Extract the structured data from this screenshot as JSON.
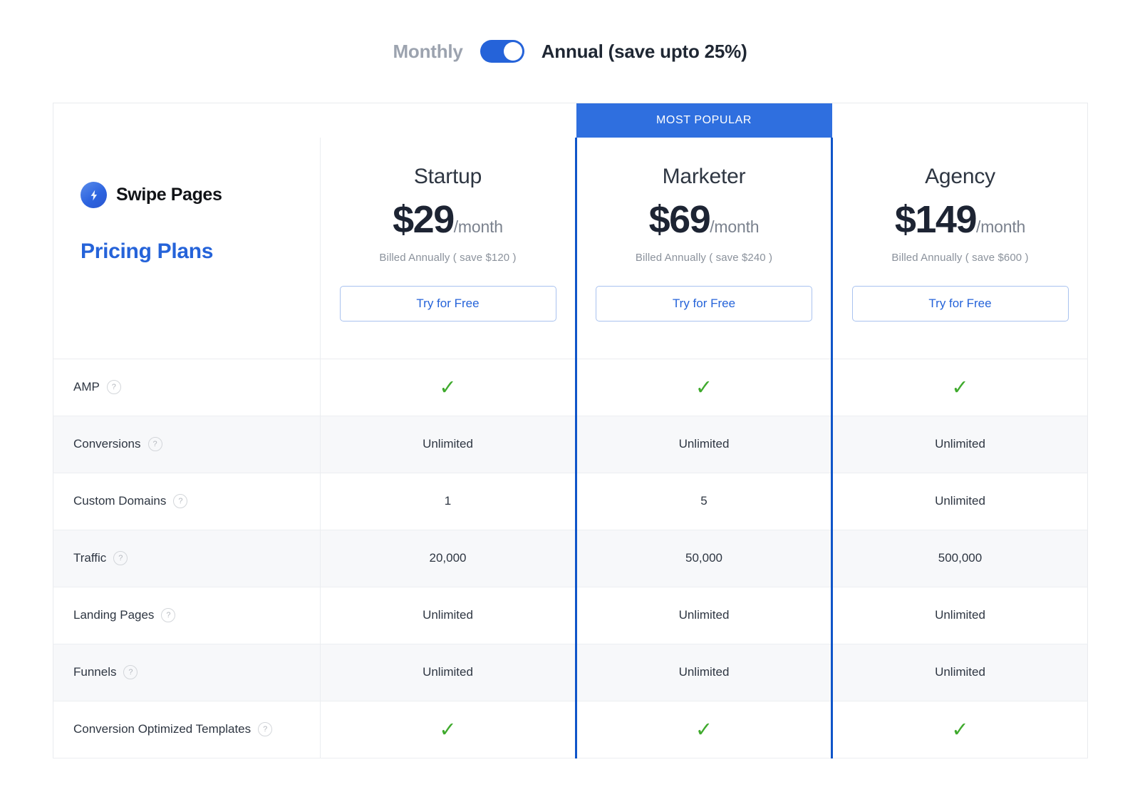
{
  "billing": {
    "monthly_label": "Monthly",
    "annual_label": "Annual (save upto 25%)",
    "toggle_state": "annual",
    "accent_color": "#2563d9"
  },
  "brand": {
    "name": "Swipe Pages",
    "logo_icon": "lightning-bolt-icon",
    "page_title": "Pricing Plans",
    "title_color": "#2563d9"
  },
  "popular_badge": {
    "label": "MOST POPULAR",
    "plan": "Marketer",
    "background": "#2f6fdf",
    "border_color": "#0f55c9"
  },
  "plans": [
    {
      "name": "Startup",
      "price": "$29",
      "period": "/month",
      "billed_note": "Billed Annually ( save $120 )",
      "cta": "Try for Free",
      "popular": false
    },
    {
      "name": "Marketer",
      "price": "$69",
      "period": "/month",
      "billed_note": "Billed Annually ( save $240 )",
      "cta": "Try for Free",
      "popular": true
    },
    {
      "name": "Agency",
      "price": "$149",
      "period": "/month",
      "billed_note": "Billed Annually ( save $600 )",
      "cta": "Try for Free",
      "popular": false
    }
  ],
  "features": [
    {
      "label": "AMP",
      "help": "?",
      "startup": "check",
      "marketer": "check",
      "agency": "check"
    },
    {
      "label": "Conversions",
      "help": "?",
      "startup": "Unlimited",
      "marketer": "Unlimited",
      "agency": "Unlimited"
    },
    {
      "label": "Custom Domains",
      "help": "?",
      "startup": "1",
      "marketer": "5",
      "agency": "Unlimited"
    },
    {
      "label": "Traffic",
      "help": "?",
      "startup": "20,000",
      "marketer": "50,000",
      "agency": "500,000"
    },
    {
      "label": "Landing Pages",
      "help": "?",
      "startup": "Unlimited",
      "marketer": "Unlimited",
      "agency": "Unlimited"
    },
    {
      "label": "Funnels",
      "help": "?",
      "startup": "Unlimited",
      "marketer": "Unlimited",
      "agency": "Unlimited"
    },
    {
      "label": "Conversion Optimized Templates",
      "help": "?",
      "startup": "check",
      "marketer": "check",
      "agency": "check"
    }
  ],
  "icons": {
    "check_glyph": "✓",
    "check_color": "#3faa2d",
    "help_glyph": "?"
  }
}
